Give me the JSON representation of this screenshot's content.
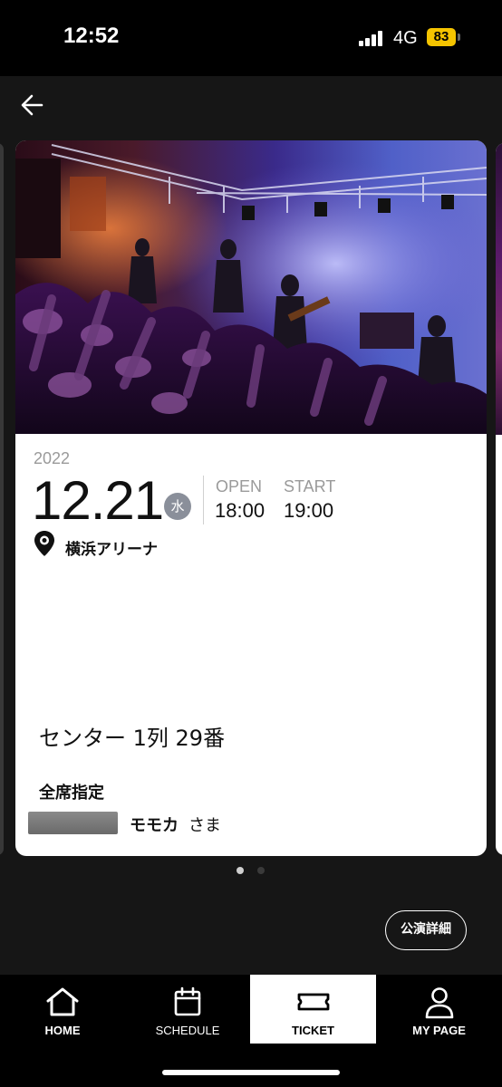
{
  "status_bar": {
    "time": "12:52",
    "network": "4G",
    "battery": "83"
  },
  "ticket": {
    "year": "2022",
    "date": "12.21",
    "weekday": "水",
    "open_label": "OPEN",
    "open_time": "18:00",
    "start_label": "START",
    "start_time": "19:00",
    "venue": "横浜アリーナ",
    "seat": "センター 1列 29番",
    "seat_type": "全席指定",
    "holder_name": "モモカ",
    "holder_suffix": "さま"
  },
  "pagination": {
    "count": 2,
    "active_index": 0
  },
  "detail_button_label": "公演詳細",
  "tabs": [
    {
      "label": "HOME",
      "icon": "home-icon",
      "active": false
    },
    {
      "label": "SCHEDULE",
      "icon": "calendar-icon",
      "active": false
    },
    {
      "label": "TICKET",
      "icon": "ticket-icon",
      "active": true
    },
    {
      "label": "MY PAGE",
      "icon": "user-icon",
      "active": false
    }
  ],
  "colors": {
    "background": "#161616",
    "card": "#ffffff",
    "weekday_badge": "#8a8f9a",
    "battery": "#f5c400"
  }
}
